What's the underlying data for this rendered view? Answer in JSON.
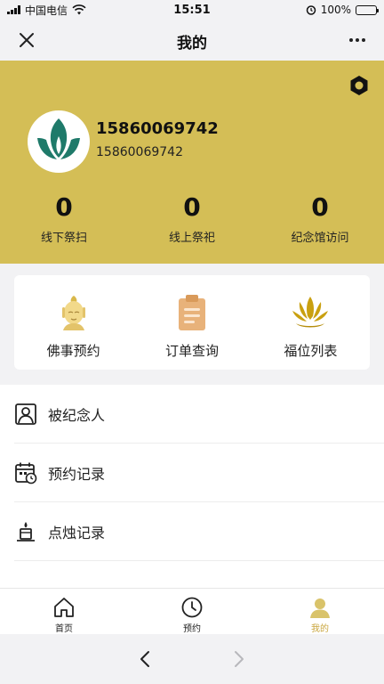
{
  "status_bar": {
    "carrier": "中国电信",
    "time": "15:51",
    "battery": "100%"
  },
  "navbar": {
    "title": "我的"
  },
  "profile": {
    "phone_primary": "15860069742",
    "phone_secondary": "15860069742",
    "stats": [
      {
        "value": "0",
        "label": "线下祭扫"
      },
      {
        "value": "0",
        "label": "线上祭祀"
      },
      {
        "value": "0",
        "label": "纪念馆访问"
      }
    ]
  },
  "quick_actions": [
    {
      "label": "佛事预约",
      "icon": "buddha-head-icon"
    },
    {
      "label": "订单查询",
      "icon": "clipboard-icon"
    },
    {
      "label": "福位列表",
      "icon": "lotus-icon"
    }
  ],
  "menu": [
    {
      "label": "被纪念人",
      "icon": "person-frame-icon"
    },
    {
      "label": "预约记录",
      "icon": "calendar-clock-icon"
    },
    {
      "label": "点烛记录",
      "icon": "candle-icon"
    }
  ],
  "tabbar": [
    {
      "label": "首页",
      "icon": "home-icon"
    },
    {
      "label": "预约",
      "icon": "clock-icon"
    },
    {
      "label": "我的",
      "icon": "user-icon",
      "active": true
    }
  ],
  "colors": {
    "header_bg": "#d4be56",
    "accent": "#c9a63e",
    "logo_green": "#1f7a6a"
  }
}
